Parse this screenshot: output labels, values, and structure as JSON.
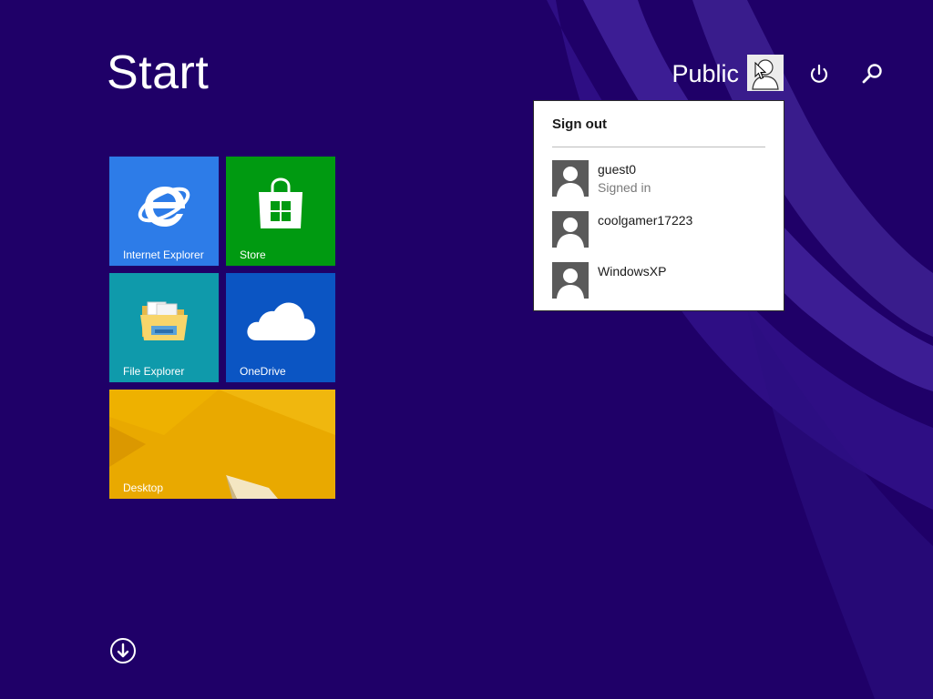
{
  "screen": {
    "title": "Start",
    "background_color": "#1f0068"
  },
  "account": {
    "name": "Public",
    "avatar_icon": "user-silhouette-icon"
  },
  "top_buttons": {
    "power_icon": "power-icon",
    "search_icon": "search-icon"
  },
  "tiles": [
    {
      "label": "Internet Explorer",
      "icon": "internet-explorer-icon",
      "color": "#2d7ce8"
    },
    {
      "label": "Store",
      "icon": "store-bag-icon",
      "color": "#009a11"
    },
    {
      "label": "File Explorer",
      "icon": "folder-icon",
      "color": "#0f9aab"
    },
    {
      "label": "OneDrive",
      "icon": "cloud-icon",
      "color": "#0b55c3"
    },
    {
      "label": "Desktop",
      "icon": "desktop-wallpaper",
      "color": "#e8a800"
    }
  ],
  "account_flyout": {
    "sign_out_label": "Sign out",
    "users": [
      {
        "name": "guest0",
        "status": "Signed in"
      },
      {
        "name": "coolgamer17223",
        "status": ""
      },
      {
        "name": "WindowsXP",
        "status": ""
      }
    ]
  },
  "all_apps_icon": "arrow-down-circle-icon"
}
